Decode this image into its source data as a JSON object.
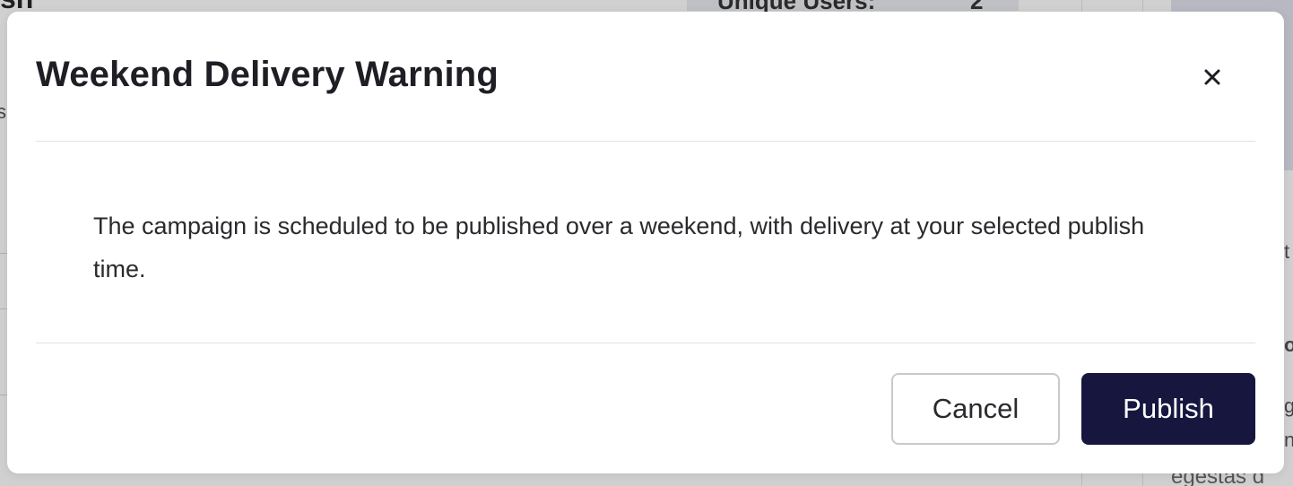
{
  "background": {
    "title_fragment": "sh",
    "stat_label": "Unique Users:",
    "stat_value": "2",
    "side_fragments": [
      "s",
      "t",
      "o",
      "g",
      "n"
    ],
    "body_text_fragment": "egestas d"
  },
  "modal": {
    "title": "Weekend Delivery Warning",
    "close_icon": "close-icon",
    "message": "The campaign is scheduled to be published over a weekend, with delivery at your selected publish time.",
    "cancel_label": "Cancel",
    "publish_label": "Publish"
  },
  "colors": {
    "primary": "#17163f",
    "overlay": "#d0d0d0",
    "text": "#2a2a2e"
  }
}
